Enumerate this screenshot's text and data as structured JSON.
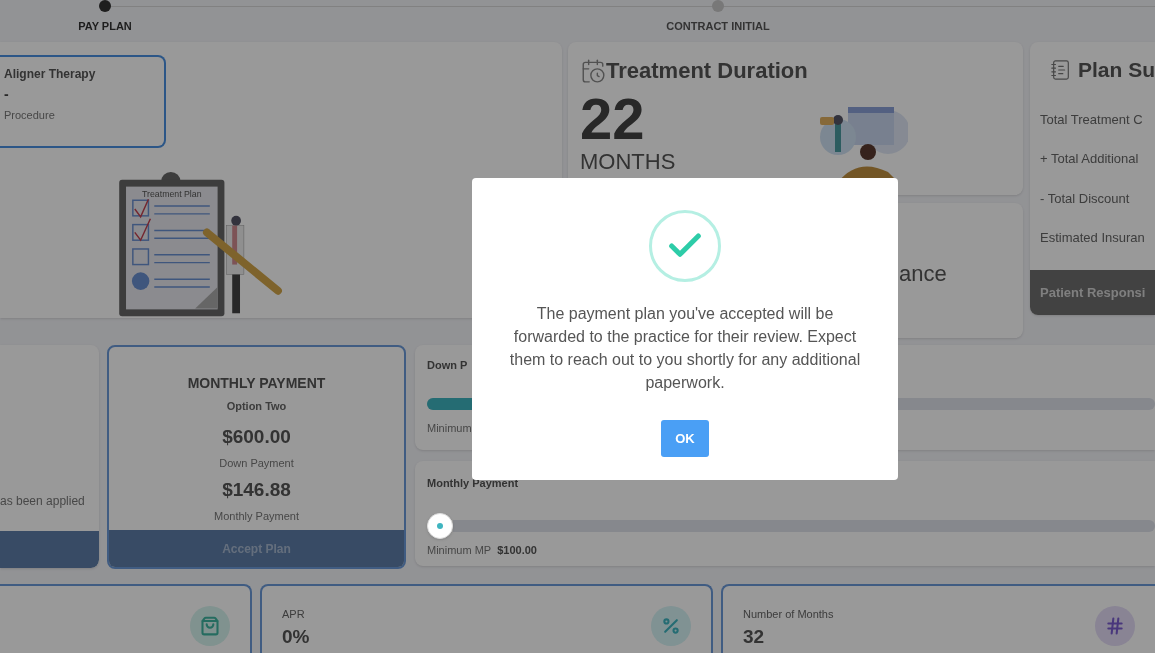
{
  "stepper": {
    "steps": [
      {
        "label": "PAY PLAN",
        "selected": true
      },
      {
        "label": "CONTRACT INITIAL",
        "selected": false
      }
    ]
  },
  "procedure_card": {
    "title": "Aligner Therapy",
    "value": "-",
    "caption": "Procedure"
  },
  "illustration": {
    "caption": "Treatment Plan"
  },
  "treatment_duration": {
    "title": "Treatment Duration",
    "value": "22",
    "unit": "MONTHS"
  },
  "insurance_card": {
    "title_fragment": "ance"
  },
  "plan_summary": {
    "title": "Plan Su",
    "rows": [
      "Total Treatment C",
      "+ Total Additional",
      "- Total Discount",
      "Estimated Insuran"
    ],
    "footer": "Patient Responsi"
  },
  "option_one": {
    "note": "as been applied"
  },
  "option_two": {
    "heading": "MONTHLY PAYMENT",
    "option": "Option Two",
    "down_payment_amount": "$600.00",
    "down_payment_label": "Down Payment",
    "monthly_amount": "$146.88",
    "monthly_label": "Monthly Payment",
    "button": "Accept Plan"
  },
  "down_payment_slider": {
    "label": "Down P",
    "level": 0.1,
    "min_label": "Minimum"
  },
  "monthly_payment_slider": {
    "label": "Monthly Payment",
    "min_label": "Minimum MP",
    "min_value": "$100.00"
  },
  "stats": [
    {
      "kind": "bag"
    },
    {
      "kind": "percent",
      "label": "APR",
      "value": "0%"
    },
    {
      "kind": "hash",
      "label": "Number of Months",
      "value": "32"
    }
  ],
  "dialog": {
    "message": "The payment plan you've accepted will be forwarded to the practice for their review. Expect them to reach out to you shortly for any additional paperwork.",
    "button": "OK"
  }
}
